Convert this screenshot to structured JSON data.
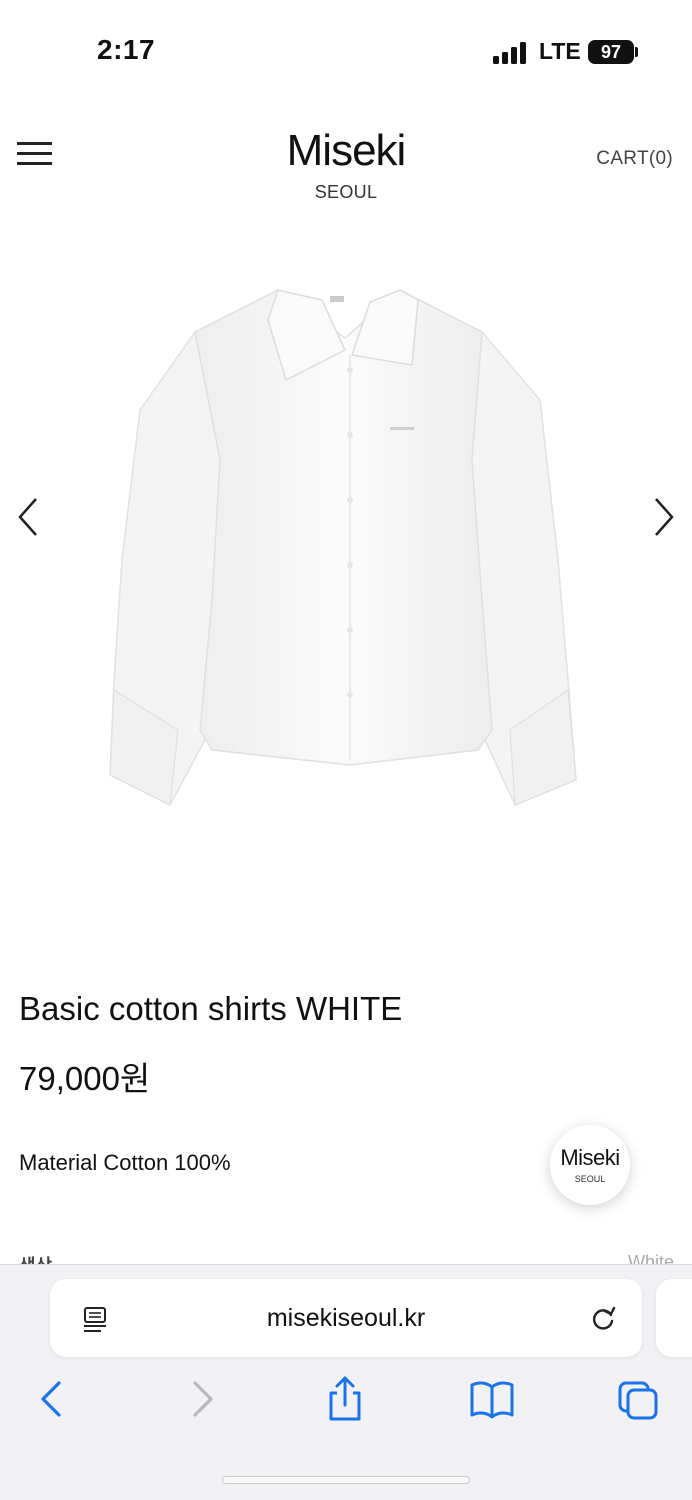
{
  "status_bar": {
    "time": "2:17",
    "network": "LTE",
    "battery": "97"
  },
  "header": {
    "logo_main": "Miseki",
    "logo_sub": "SEOUL",
    "cart_label": "CART(0)",
    "menu_icon": "hamburger-menu-icon"
  },
  "carousel": {
    "prev_icon": "chevron-left-icon",
    "next_icon": "chevron-right-icon"
  },
  "product": {
    "title": "Basic cotton shirts WHITE",
    "price": "79,000원",
    "material": "Material Cotton 100%",
    "option_label": "색상",
    "option_value": "White"
  },
  "floating_badge": {
    "main": "Miseki",
    "sub": "SEOUL"
  },
  "browser": {
    "url": "misekiseoul.kr",
    "toolbar_icons": [
      "back-icon",
      "forward-icon",
      "share-icon",
      "bookmarks-icon",
      "tabs-icon"
    ],
    "accent_color": "#1a73e8"
  }
}
